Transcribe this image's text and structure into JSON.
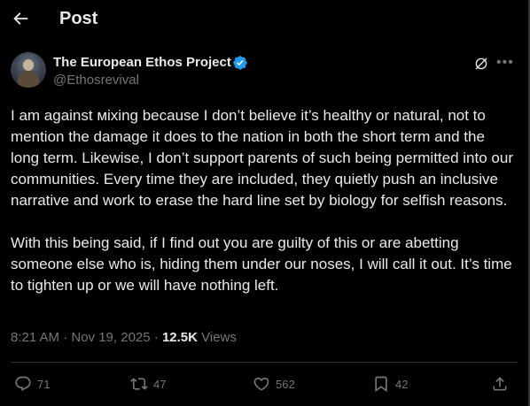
{
  "header": {
    "title": "Post",
    "back_icon": "arrow-left-icon"
  },
  "post": {
    "author_name": "The European Ethos Project",
    "handle": "@Ethosrevival",
    "verified_color": "#1d9bf0",
    "text": "I am against ᴍixing because I don’t believe it’s healthy or natural, not to mention the damage it does to the nation in both the short term and the long term. Likewise, I don’t support parents of such being permitted into our communities. Every time they are included, they quietly push an inclusive narrative and work to erase the hard line set by biology for selfish reasons.\n\nWith this being said, if I find out you are guilty of this or are abetting someone else who is, hiding them under our noses, I will call it out. It’s time to tighten up or we will have nothing left.",
    "timestamp": "8:21 AM · Nov 19, 2025 · ",
    "views_count": "12.5K",
    "views_label": " Views"
  },
  "actions": {
    "replies": "71",
    "reposts": "47",
    "likes": "562",
    "bookmarks": "42"
  },
  "colors": {
    "background": "#000000",
    "text": "#e7e9ea",
    "muted": "#71767b",
    "border": "#2f3336"
  }
}
